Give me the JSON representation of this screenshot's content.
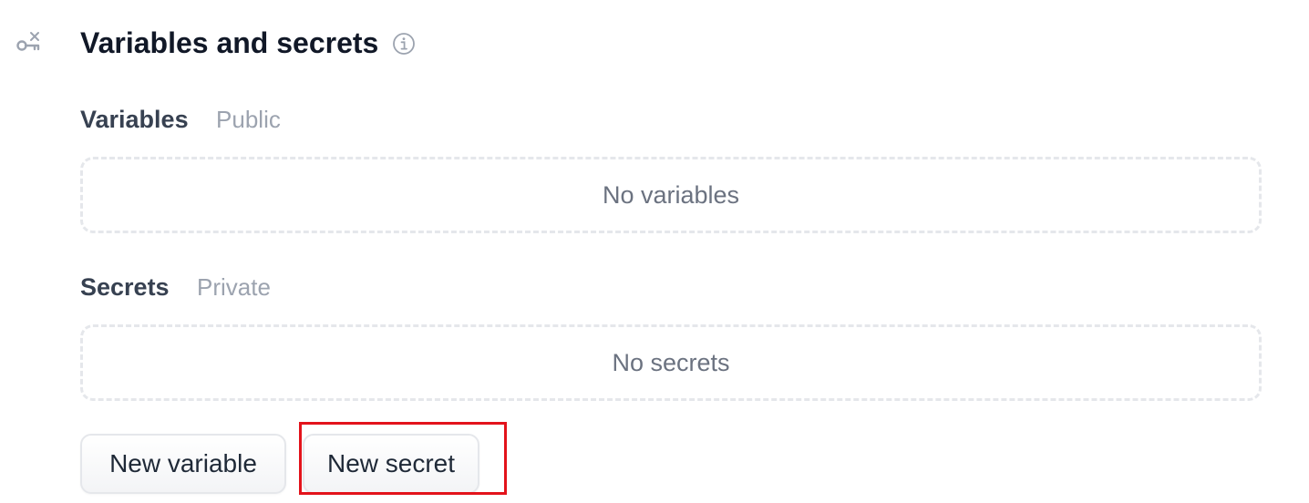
{
  "section": {
    "icon": "variable-key-icon",
    "title": "Variables and secrets",
    "info_icon": "info-circle-icon"
  },
  "variables": {
    "heading": "Variables",
    "badge": "Public",
    "empty_text": "No variables"
  },
  "secrets": {
    "heading": "Secrets",
    "badge": "Private",
    "empty_text": "No secrets"
  },
  "actions": {
    "new_variable_label": "New variable",
    "new_secret_label": "New secret"
  },
  "annotation": {
    "highlight_color": "#e3131b",
    "highlighted_target": "new-secret-button"
  }
}
